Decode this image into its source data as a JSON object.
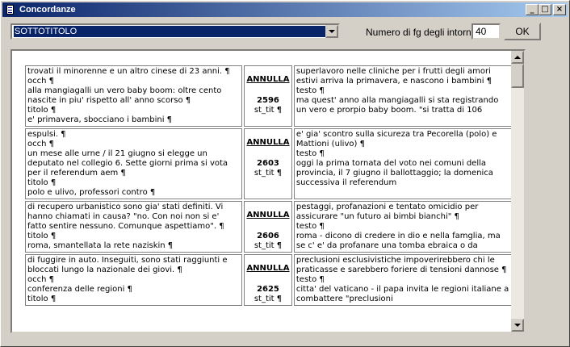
{
  "window": {
    "title": "Concordanze",
    "min_label": "_",
    "max_label": "□",
    "close_label": "×"
  },
  "toolbar": {
    "field_value": "SOTTOTITOLO",
    "context_label": "Numero di fg degli intorni",
    "context_value": "40",
    "ok_label": "OK"
  },
  "colors": {
    "title_gradient_start": "#0a246a",
    "title_gradient_end": "#a6caf0",
    "selection": "#0a246a",
    "face": "#d4d0c8"
  },
  "rows": [
    {
      "left": "trovati il minorenne e un altro cinese di 23 anni. ¶\nocch ¶\nalla mangiagalli un vero baby boom: oltre cento nascite in piu' rispetto all' anno scorso ¶\ntitolo ¶\ne' primavera, sbocciano i bambini ¶",
      "keyword": "ANNULLA",
      "number": "2596",
      "tag": "st_tit ¶",
      "right": "superlavoro nelle cliniche per i frutti degli amori estivi arriva la primavera, e nascono i bambini ¶\ntesto ¶\nma quest' anno alla mangiagalli si sta registrando un vero e prorpio baby boom. \"si tratta di 106"
    },
    {
      "left": "espulsi. ¶\nocch ¶\nun mese alle urne / il 21 giugno si elegge un deputato nel collegio 6. Sette giorni prima si vota per il referendum aem ¶\ntitolo ¶\npolo e ulivo, professori contro ¶",
      "keyword": "ANNULLA",
      "number": "2603",
      "tag": "st_tit ¶",
      "right": "e' gia' scontro sulla sicureza tra Pecorella (polo) e Mattioni (ulivo) ¶\ntesto ¶\noggi la prima tornata del voto nei comuni della provincia, il 7 giugno il ballottaggio; la domenica successiva il referendum"
    },
    {
      "left": "di recupero urbanistico sono gia' stati definiti. Vi hanno chiamati in causa? \"no. Con noi non si e' fatto sentire nessuno. Comunque aspettiamo\". ¶\ntitolo ¶\nroma, smantellata la rete naziskin ¶",
      "keyword": "ANNULLA",
      "number": "2606",
      "tag": "st_tit ¶",
      "right": "pestaggi, profanazioni e tentato omicidio per assicurare \"un futuro ai bimbi bianchi\" ¶\ntesto ¶\nroma - dicono di credere in dio e nella famglia, ma se c' e' da profanare una tomba ebraica o da"
    },
    {
      "left": "di fuggire in auto. Inseguiti, sono stati raggiunti e bloccati lungo la nazionale dei giovi. ¶\nocch ¶\nconferenza delle regioni ¶\ntitolo ¶",
      "keyword": "ANNULLA",
      "number": "2625",
      "tag": "st_tit ¶",
      "right": "preclusioni esclusivistiche impoverirebbero chi le praticasse e sarebbero foriere di tensioni dannose ¶\ntesto ¶\ncitta' del vaticano - il papa invita le regioni italiane a combattere \"preclusioni"
    }
  ]
}
